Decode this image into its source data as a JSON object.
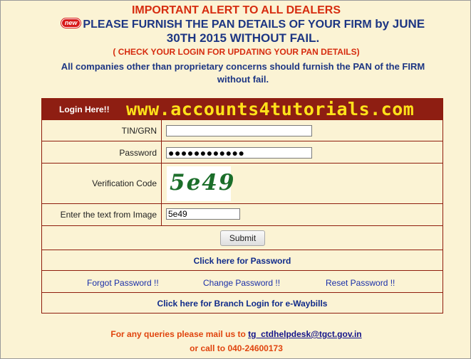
{
  "alert": {
    "title": "IMPORTANT ALERT TO ALL DEALERS",
    "new_badge": "new",
    "line_main": "PLEASE FURNISH THE PAN DETAILS OF YOUR FIRM",
    "line_by": "by JUNE",
    "line_date": "30TH 2015 WITHOUT FAIL.",
    "check_login": "( CHECK YOUR LOGIN FOR UPDATING YOUR PAN DETAILS)",
    "companies_note": "All companies other than proprietary concerns should furnish the PAN of the FIRM without fail."
  },
  "login": {
    "header_label": "Login Here!!",
    "watermark": "www.accounts4tutorials.com",
    "tin_label": "TIN/GRN",
    "tin_value": "",
    "password_label": "Password",
    "password_value": "●●●●●●●●●●●●",
    "verification_label": "Verification Code",
    "captcha_text": "5e49",
    "image_text_label": "Enter the text from Image",
    "image_text_value": "5e49",
    "submit_label": "Submit",
    "password_link": "Click here for Password",
    "forgot_password": "Forgot Password !!",
    "change_password": "Change Password !!",
    "reset_password": "Reset Password !!",
    "branch_login": "Click here for Branch Login for e-Waybills"
  },
  "footer": {
    "queries_text": "For any queries please mail us to",
    "email": "tg_ctdhelpdesk@tgct.gov.in",
    "call_text": "or call to 040-24600173"
  }
}
